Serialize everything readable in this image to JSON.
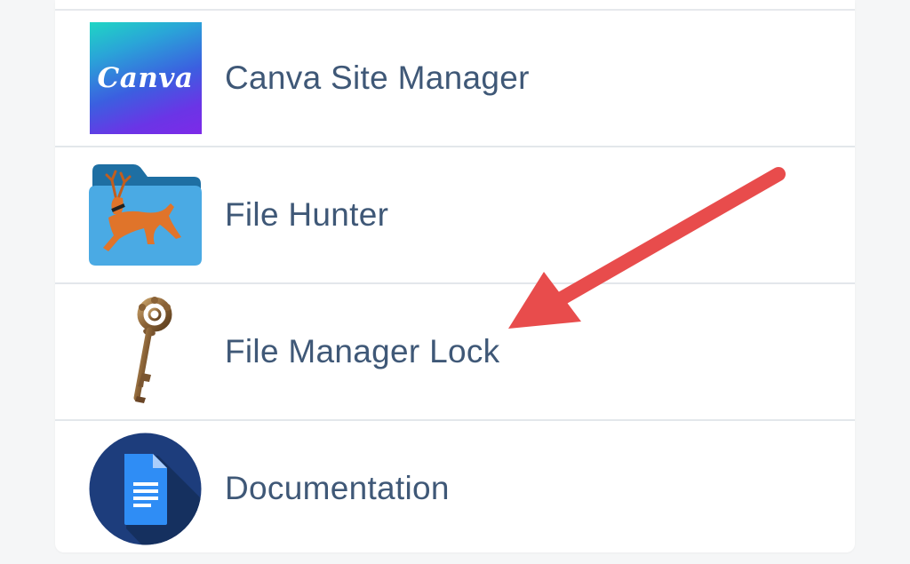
{
  "list": {
    "items": [
      {
        "label": "Canva Site Manager",
        "icon": "canva-logo-icon",
        "icon_text": "Canva"
      },
      {
        "label": "File Hunter",
        "icon": "deer-folder-icon"
      },
      {
        "label": "File Manager Lock",
        "icon": "antique-key-icon"
      },
      {
        "label": "Documentation",
        "icon": "document-icon"
      }
    ]
  },
  "annotation": {
    "icon": "red-arrow-icon",
    "color": "#e84c4c",
    "points_to": "File Manager Lock"
  },
  "colors": {
    "label_text": "#3f5877",
    "divider": "#e3e7eb",
    "card_background": "#ffffff",
    "page_background": "#f5f6f7"
  }
}
